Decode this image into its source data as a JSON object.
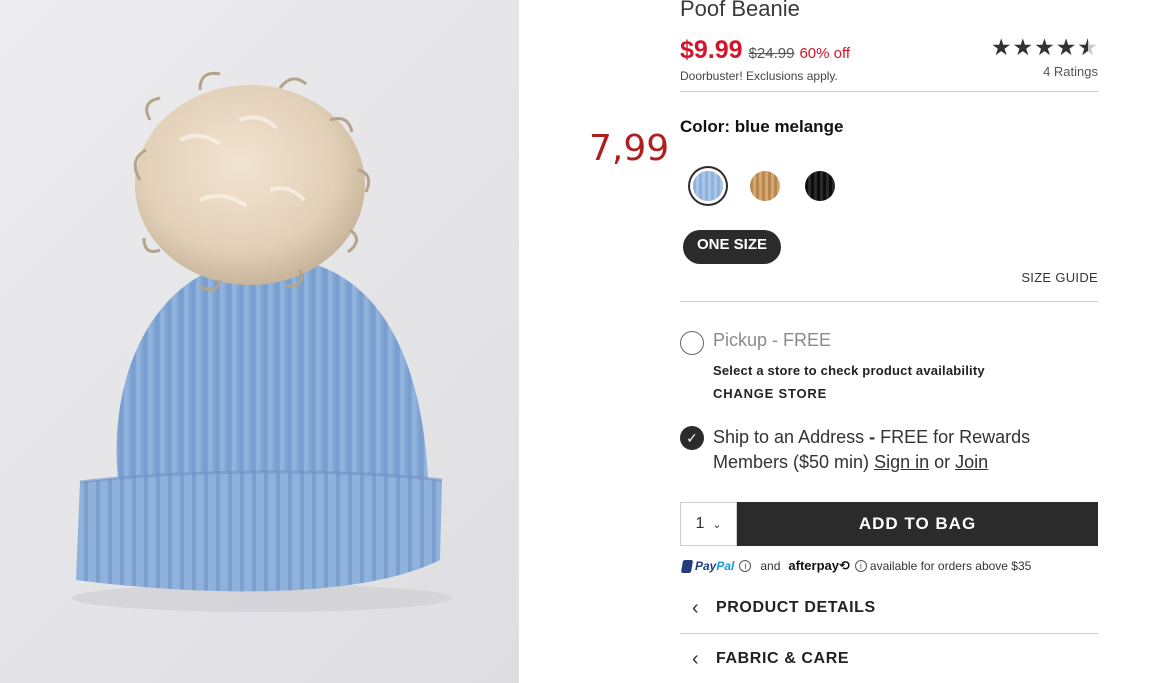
{
  "product": {
    "title": "Poof Beanie",
    "image_alt": "Blue ribbed beanie with faux-fur pom"
  },
  "alt_price": "7,99",
  "price": {
    "sale": "$9.99",
    "regular": "$24.99",
    "discount": "60% off",
    "note": "Doorbuster! Exclusions apply."
  },
  "rating": {
    "value": 4.5,
    "max": 5,
    "count_label": "4 Ratings"
  },
  "color": {
    "label": "Color: blue melange",
    "swatches": [
      {
        "name": "blue melange",
        "hex": "#9dbce2",
        "selected": true
      },
      {
        "name": "tan",
        "hex": "#c79a62",
        "selected": false
      },
      {
        "name": "black",
        "hex": "#111111",
        "selected": false
      }
    ]
  },
  "size": {
    "selected": "ONE SIZE",
    "guide_label": "SIZE GUIDE"
  },
  "fulfillment": {
    "pickup": {
      "label": "Pickup",
      "separator": " - ",
      "price": "FREE",
      "note": "Select a store to check product availability",
      "change_store": "CHANGE STORE",
      "selected": false
    },
    "ship": {
      "label": "Ship to an Address",
      "dash": " - ",
      "text": "FREE for Rewards Members ($50 min)",
      "sign_in": "Sign in",
      "or": "or",
      "join": "Join",
      "selected": true
    }
  },
  "purchase": {
    "quantity": "1",
    "add_to_bag": "ADD TO BAG"
  },
  "payment": {
    "paypal_a": "Pay",
    "paypal_b": "Pal",
    "and": "and",
    "afterpay": "afterpay",
    "note": "available for orders above $35"
  },
  "accordions": [
    {
      "label": "PRODUCT DETAILS"
    },
    {
      "label": "FABRIC & CARE"
    }
  ],
  "colors": {
    "sale_red": "#d4142a",
    "alt_price_red": "#b01f1f",
    "button_dark": "#2b2b2b"
  }
}
